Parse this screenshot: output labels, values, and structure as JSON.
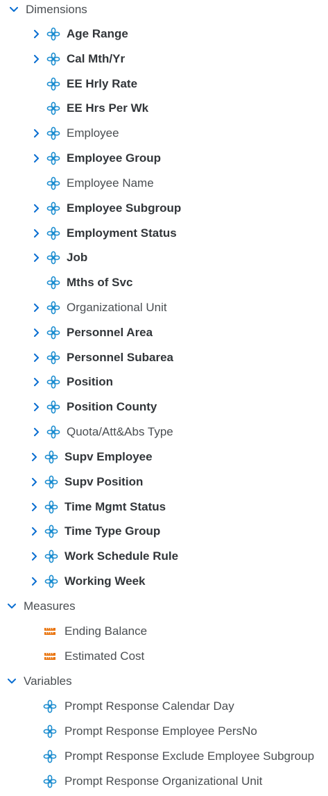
{
  "tree": {
    "sections": [
      {
        "label": "Dimensions",
        "items": [
          {
            "label": "Age Range",
            "bold": true,
            "expandable": true,
            "icon": "dimension-icon"
          },
          {
            "label": "Cal Mth/Yr",
            "bold": true,
            "expandable": true,
            "icon": "dimension-icon"
          },
          {
            "label": "EE Hrly Rate",
            "bold": true,
            "expandable": false,
            "icon": "dimension-icon"
          },
          {
            "label": "EE Hrs Per Wk",
            "bold": true,
            "expandable": false,
            "icon": "dimension-icon"
          },
          {
            "label": "Employee",
            "bold": false,
            "expandable": true,
            "icon": "dimension-icon"
          },
          {
            "label": "Employee Group",
            "bold": true,
            "expandable": true,
            "icon": "dimension-icon"
          },
          {
            "label": "Employee Name",
            "bold": false,
            "expandable": false,
            "icon": "dimension-icon"
          },
          {
            "label": "Employee Subgroup",
            "bold": true,
            "expandable": true,
            "icon": "dimension-icon"
          },
          {
            "label": "Employment Status",
            "bold": true,
            "expandable": true,
            "icon": "dimension-icon"
          },
          {
            "label": "Job",
            "bold": true,
            "expandable": true,
            "icon": "dimension-icon"
          },
          {
            "label": "Mths of Svc",
            "bold": true,
            "expandable": false,
            "icon": "dimension-icon"
          },
          {
            "label": "Organizational Unit",
            "bold": false,
            "expandable": true,
            "icon": "dimension-icon"
          },
          {
            "label": "Personnel Area",
            "bold": true,
            "expandable": true,
            "icon": "dimension-icon"
          },
          {
            "label": "Personnel Subarea",
            "bold": true,
            "expandable": true,
            "icon": "dimension-icon"
          },
          {
            "label": "Position",
            "bold": true,
            "expandable": true,
            "icon": "dimension-icon"
          },
          {
            "label": "Position County",
            "bold": true,
            "expandable": true,
            "icon": "dimension-icon"
          },
          {
            "label": "Quota/Att&Abs Type",
            "bold": false,
            "expandable": true,
            "icon": "dimension-icon"
          },
          {
            "label": "Supv Employee",
            "bold": true,
            "expandable": true,
            "icon": "dimension-icon"
          },
          {
            "label": "Supv Position",
            "bold": true,
            "expandable": true,
            "icon": "dimension-icon"
          },
          {
            "label": "Time Mgmt Status",
            "bold": true,
            "expandable": true,
            "icon": "dimension-icon"
          },
          {
            "label": "Time Type Group",
            "bold": true,
            "expandable": true,
            "icon": "dimension-icon"
          },
          {
            "label": "Work Schedule Rule",
            "bold": true,
            "expandable": true,
            "icon": "dimension-icon"
          },
          {
            "label": "Working Week",
            "bold": true,
            "expandable": true,
            "icon": "dimension-icon"
          }
        ]
      },
      {
        "label": "Measures",
        "items": [
          {
            "label": "Ending Balance",
            "bold": false,
            "expandable": false,
            "icon": "measure-icon"
          },
          {
            "label": "Estimated Cost",
            "bold": false,
            "expandable": false,
            "icon": "measure-icon"
          }
        ]
      },
      {
        "label": "Variables",
        "items": [
          {
            "label": "Prompt Response Calendar Day",
            "bold": false,
            "expandable": false,
            "icon": "dimension-icon"
          },
          {
            "label": "Prompt Response Employee PersNo",
            "bold": false,
            "expandable": false,
            "icon": "dimension-icon"
          },
          {
            "label": "Prompt Response Exclude Employee Subgroup",
            "bold": false,
            "expandable": false,
            "icon": "dimension-icon"
          },
          {
            "label": "Prompt Response Organizational Unit",
            "bold": false,
            "expandable": false,
            "icon": "dimension-icon"
          }
        ]
      }
    ]
  },
  "colors": {
    "chevron": "#0a6ed1",
    "dimension_icon": "#1c8dd0",
    "measure_icon": "#e9730c",
    "text_bold": "#32363a",
    "text_normal": "#4a4e52"
  }
}
